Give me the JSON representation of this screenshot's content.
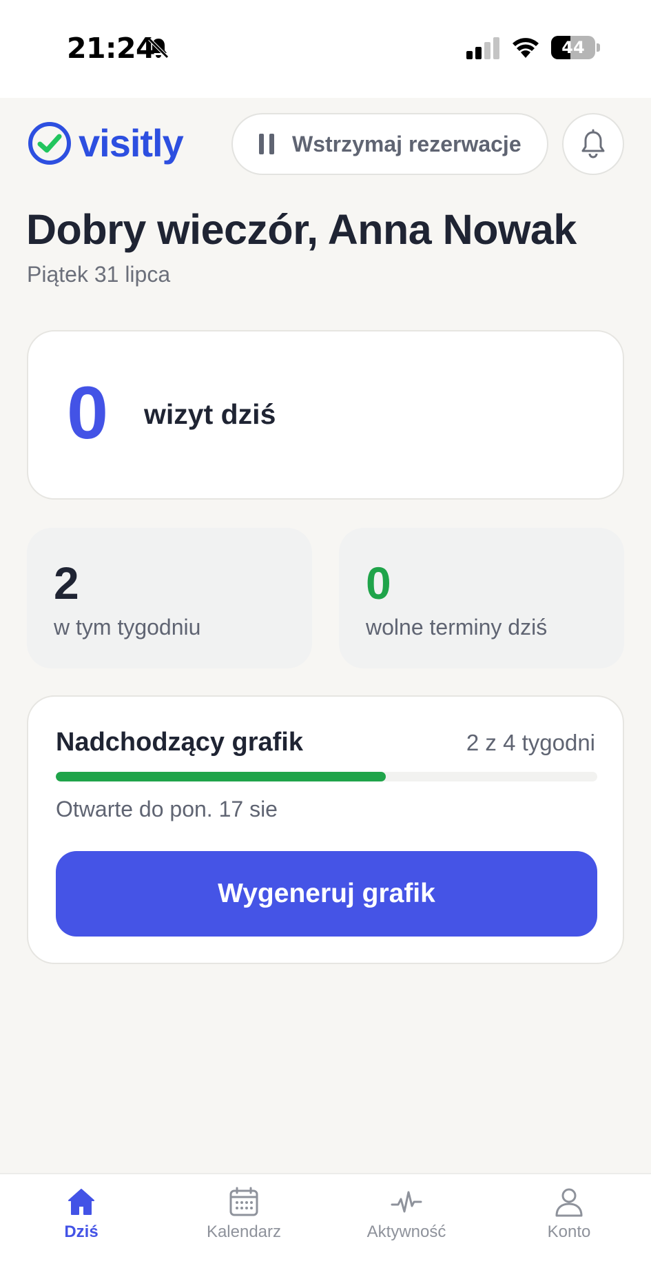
{
  "status_bar": {
    "time": "21:24",
    "battery": "44",
    "battery_level": 0.44
  },
  "header": {
    "brand": "visitly",
    "pause_button_label": "Wstrzymaj rezerwacje",
    "notification_icon": "bell-icon"
  },
  "greeting": {
    "title": "Dobry wieczór, Anna Nowak",
    "date": "Piątek 31 lipca"
  },
  "today": {
    "count": "0",
    "label": "wizyt dziś"
  },
  "stats": [
    {
      "value": "2",
      "label": "w tym tygodniu",
      "color": "#1f2433"
    },
    {
      "value": "0",
      "label": "wolne terminy dziś",
      "color": "#1fa44a"
    }
  ],
  "schedule": {
    "title": "Nadchodzący grafik",
    "count": "2 z 4 tygodni",
    "progress": 0.61,
    "open_until": "Otwarte do pon. 17 sie",
    "button_label": "Wygeneruj grafik"
  },
  "colors": {
    "accent": "#4353e6",
    "brand": "#2d4fe0",
    "success": "#1fa44a",
    "logo_check": "#22c55e"
  },
  "tabs": [
    {
      "label": "Dziś",
      "icon": "home-icon",
      "active": true
    },
    {
      "label": "Kalendarz",
      "icon": "calendar-icon",
      "active": false
    },
    {
      "label": "Aktywność",
      "icon": "activity-icon",
      "active": false
    },
    {
      "label": "Konto",
      "icon": "user-icon",
      "active": false
    }
  ]
}
